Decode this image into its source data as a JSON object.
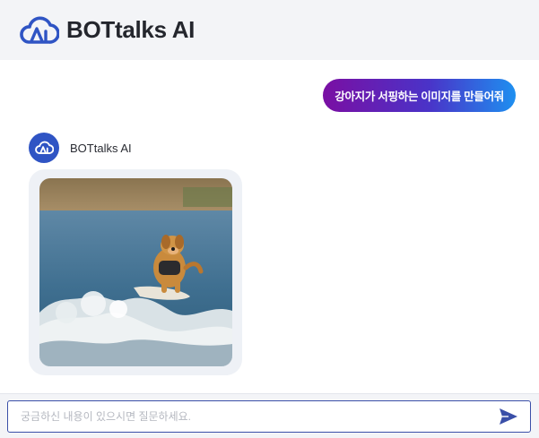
{
  "header": {
    "brand": "BOTtalks AI",
    "logo_icon": "cloud-ai-logo-icon"
  },
  "chat": {
    "user_message": "강아지가 서핑하는 이미지를 만들어줘",
    "bot": {
      "name": "BOTtalks AI",
      "avatar_icon": "cloud-ai-logo-icon",
      "image_subject": "golden retriever surfing on a wave"
    }
  },
  "composer": {
    "placeholder": "궁금하신 내용이 있으시면 질문하세요.",
    "value": "",
    "send_icon": "send-arrow-icon"
  },
  "colors": {
    "brand_blue": "#2f54c4",
    "header_bg": "#f3f4f7",
    "bubble_gradient": [
      "#7a0fa3",
      "#4a33c8",
      "#1e8ff0"
    ],
    "input_border": "#3a4fa8"
  }
}
